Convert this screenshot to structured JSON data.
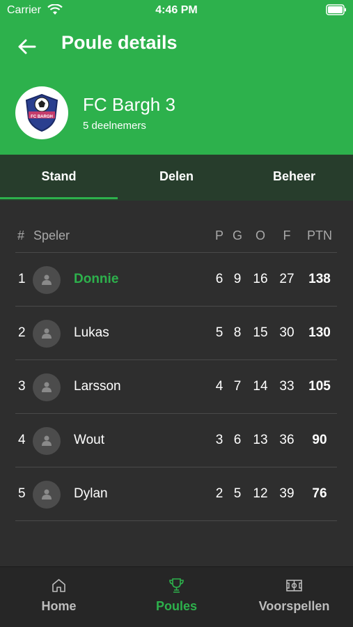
{
  "status_bar": {
    "carrier": "Carrier",
    "time": "4:46 PM"
  },
  "header": {
    "title": "Poule details",
    "group_name": "FC Bargh 3",
    "participants": "5 deelnemers",
    "logo_text": "FC BARGH",
    "color": "#2db14c"
  },
  "tabs": [
    {
      "label": "Stand",
      "active": true
    },
    {
      "label": "Delen",
      "active": false
    },
    {
      "label": "Beheer",
      "active": false
    }
  ],
  "table": {
    "headers": {
      "rank": "#",
      "player": "Speler",
      "p": "P",
      "g": "G",
      "o": "O",
      "f": "F",
      "ptn": "PTN"
    },
    "rows": [
      {
        "rank": "1",
        "name": "Donnie",
        "p": "6",
        "g": "9",
        "o": "16",
        "f": "27",
        "ptn": "138"
      },
      {
        "rank": "2",
        "name": "Lukas",
        "p": "5",
        "g": "8",
        "o": "15",
        "f": "30",
        "ptn": "130"
      },
      {
        "rank": "3",
        "name": "Larsson",
        "p": "4",
        "g": "7",
        "o": "14",
        "f": "33",
        "ptn": "105"
      },
      {
        "rank": "4",
        "name": "Wout",
        "p": "3",
        "g": "6",
        "o": "13",
        "f": "36",
        "ptn": "90"
      },
      {
        "rank": "5",
        "name": "Dylan",
        "p": "2",
        "g": "5",
        "o": "12",
        "f": "39",
        "ptn": "76"
      }
    ]
  },
  "bottom_nav": [
    {
      "label": "Home",
      "icon": "home-icon",
      "active": false
    },
    {
      "label": "Poules",
      "icon": "trophy-icon",
      "active": true
    },
    {
      "label": "Voorspellen",
      "icon": "soccer-field-icon",
      "active": false
    }
  ]
}
